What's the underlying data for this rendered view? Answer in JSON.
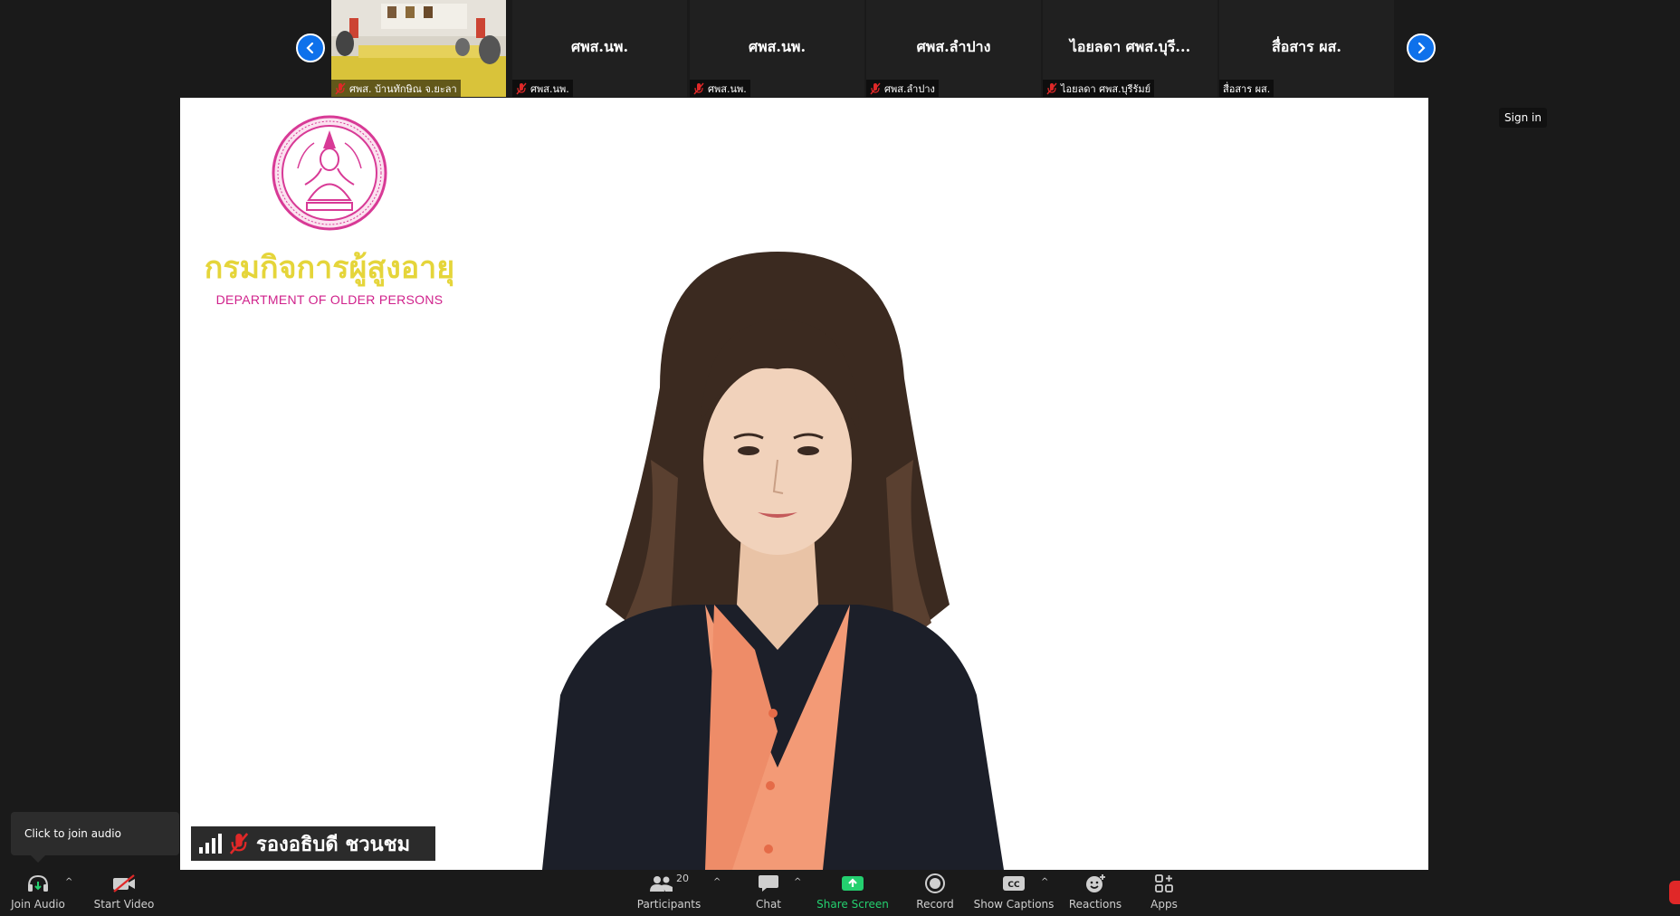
{
  "strip": {
    "thumbnails": [
      {
        "name": "",
        "label": "ศพส. บ้านทักษิณ จ.ยะลา",
        "muted": true,
        "video": true
      },
      {
        "name": "ศพส.นพ.",
        "label": "ศพส.นพ.",
        "muted": true
      },
      {
        "name": "ศพส.นพ.",
        "label": "ศพส.นพ.",
        "muted": true
      },
      {
        "name": "ศพส.ลำปาง",
        "label": "ศพส.ลำปาง",
        "muted": true
      },
      {
        "name": "ไอยลดา ศพส.บุรี...",
        "label": "ไอยลดา  ศพส.บุรีรัมย์",
        "muted": true
      },
      {
        "name": "สื่อสาร ผส.",
        "label": "สื่อสาร ผส.",
        "muted": false
      }
    ]
  },
  "main": {
    "org_name_thai": "กรมกิจการผู้สูงอายุ",
    "org_name_eng": "DEPARTMENT OF OLDER PERSONS",
    "speaker_name": "รองอธิบดี ชวนชม"
  },
  "sign_in": "Sign in",
  "tooltip": "Click to join audio",
  "toolbar": {
    "join_audio": "Join Audio",
    "start_video": "Start Video",
    "participants": "Participants",
    "participants_count": "20",
    "chat": "Chat",
    "share_screen": "Share Screen",
    "record": "Record",
    "show_captions": "Show Captions",
    "reactions": "Reactions",
    "apps": "Apps"
  },
  "colors": {
    "accent_blue": "#0e71eb",
    "share_green": "#24d06f",
    "muted_red": "#e02828",
    "org_yellow": "#e5d53a",
    "org_pink": "#d0218b"
  }
}
